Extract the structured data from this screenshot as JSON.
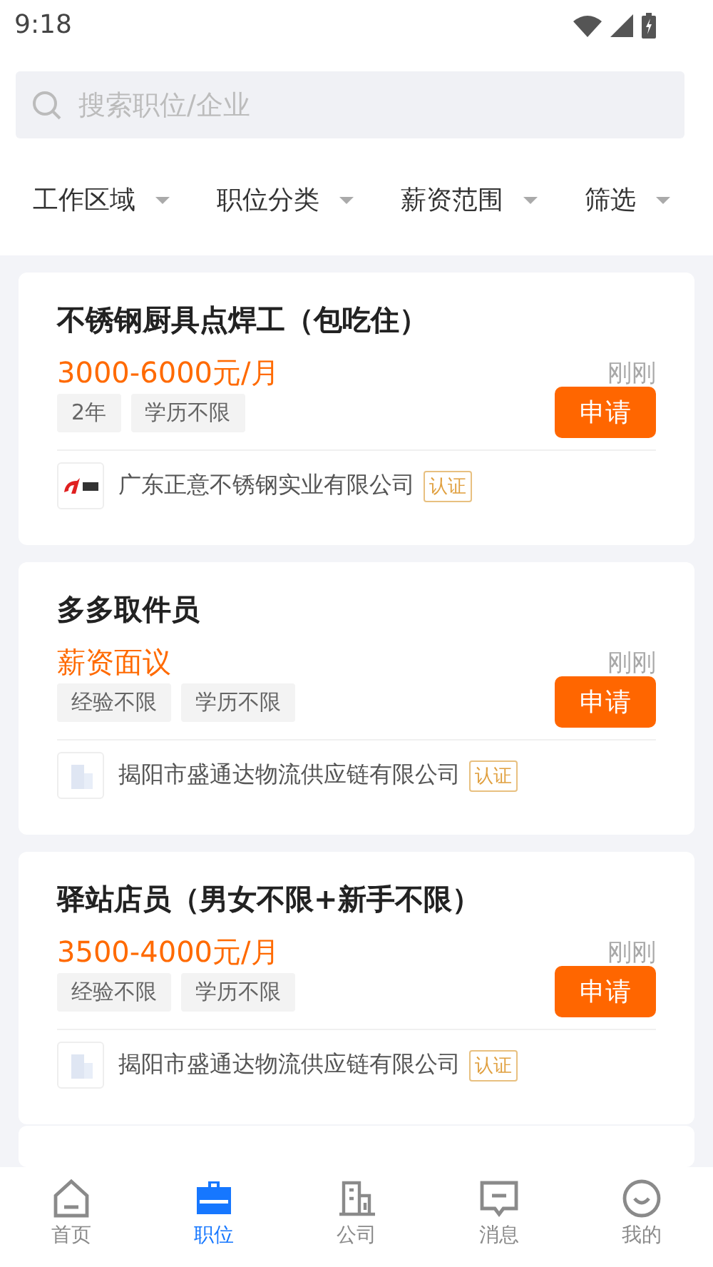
{
  "status_bar": {
    "time": "9:18"
  },
  "search": {
    "placeholder": "搜索职位/企业"
  },
  "filters": [
    {
      "label": "工作区域"
    },
    {
      "label": "职位分类"
    },
    {
      "label": "薪资范围"
    },
    {
      "label": "筛选"
    }
  ],
  "jobs": [
    {
      "title": "不锈钢厨具点焊工（包吃住）",
      "salary": "3000-6000元/月",
      "time": "刚刚",
      "tags": [
        "2年",
        "学历不限"
      ],
      "button": "申请",
      "company": "广东正意不锈钢实业有限公司",
      "kind": "brand",
      "verified": "认证"
    },
    {
      "title": "多多取件员",
      "salary": "薪资面议",
      "time": "刚刚",
      "tags": [
        "经验不限",
        "学历不限"
      ],
      "button": "申请",
      "company": "揭阳市盛通达物流供应链有限公司",
      "kind": "generic",
      "verified": "认证"
    },
    {
      "title": "驿站店员（男女不限+新手不限）",
      "salary": "3500-4000元/月",
      "time": "刚刚",
      "tags": [
        "经验不限",
        "学历不限"
      ],
      "button": "申请",
      "company": "揭阳市盛通达物流供应链有限公司",
      "kind": "generic",
      "verified": "认证"
    }
  ],
  "tab_bar": [
    {
      "label": "首页",
      "selected": false
    },
    {
      "label": "职位",
      "selected": true
    },
    {
      "label": "公司",
      "selected": false
    },
    {
      "label": "消息",
      "selected": false
    },
    {
      "label": "我的",
      "selected": false
    }
  ]
}
